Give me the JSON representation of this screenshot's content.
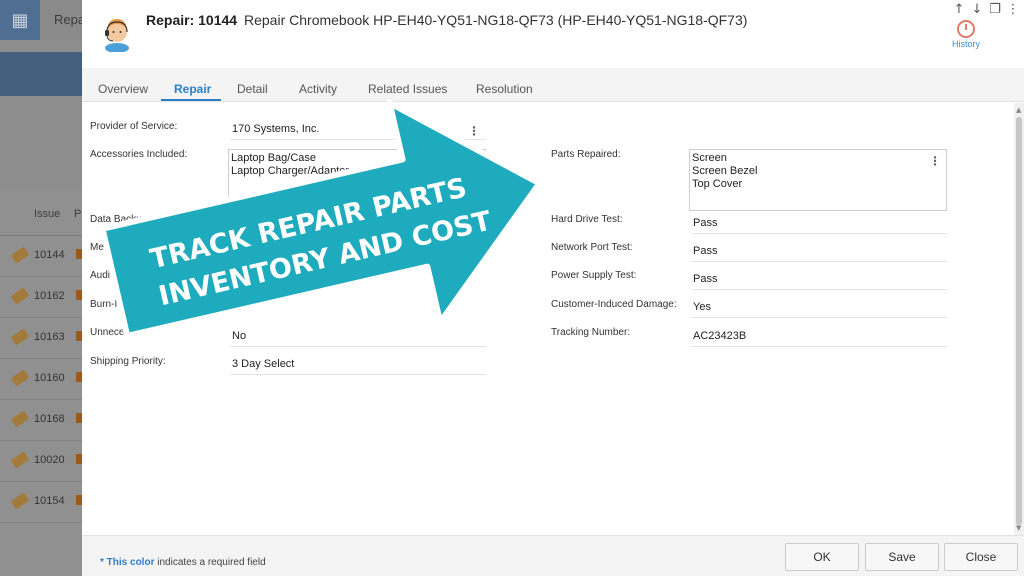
{
  "background": {
    "app_title": "Repa",
    "list_headers": [
      "Issue",
      "P"
    ],
    "rows": [
      "10144",
      "10162",
      "10163",
      "10160",
      "10168",
      "10020",
      "10154"
    ]
  },
  "modal": {
    "title_label": "Repair: 10144",
    "title_text": "Repair Chromebook HP-EH40-YQ51-NG18-QF73 (HP-EH40-YQ51-NG18-QF73)",
    "history_label": "History",
    "tabs": [
      {
        "label": "Overview"
      },
      {
        "label": "Repair"
      },
      {
        "label": "Detail"
      },
      {
        "label": "Activity"
      },
      {
        "label": "Related Issues"
      },
      {
        "label": "Resolution"
      }
    ],
    "active_tab": "Repair"
  },
  "left_fields": {
    "provider_label": "Provider of Service:",
    "provider_value": "170 Systems, Inc.",
    "accessories_label": "Accessories Included:",
    "accessories_lines": [
      "Laptop Bag/Case",
      "Laptop Charger/Adapter"
    ],
    "backup_label": "Data Backup Required:",
    "memory_label": "Memory Tes",
    "audio_label": "Audi",
    "burnin_label": "Burn-I",
    "unnecessary_label": "Unneces",
    "unnecessary_value": "No",
    "shipping_label": "Shipping Priority:",
    "shipping_value": "3 Day Select"
  },
  "right_fields": {
    "parts_label": "Parts Repaired:",
    "parts_lines": [
      "Screen",
      "Screen Bezel",
      "Top Cover"
    ],
    "hdd_label": "Hard Drive Test:",
    "hdd_value": "Pass",
    "network_label": "Network Port Test:",
    "network_value": "Pass",
    "power_label": "Power Supply Test:",
    "power_value": "Pass",
    "damage_label": "Customer-Induced Damage:",
    "damage_value": "Yes",
    "tracking_label": "Tracking Number:",
    "tracking_value": "AC23423B"
  },
  "footer": {
    "req_prefix": "* ",
    "req_highlight": "This color",
    "req_suffix": " indicates a required field",
    "ok_label": "OK",
    "save_label": "Save",
    "close_label": "Close"
  },
  "promo": {
    "line1": "TRACK REPAIR PARTS",
    "line2": "INVENTORY AND COST",
    "color": "#1eabbd"
  }
}
